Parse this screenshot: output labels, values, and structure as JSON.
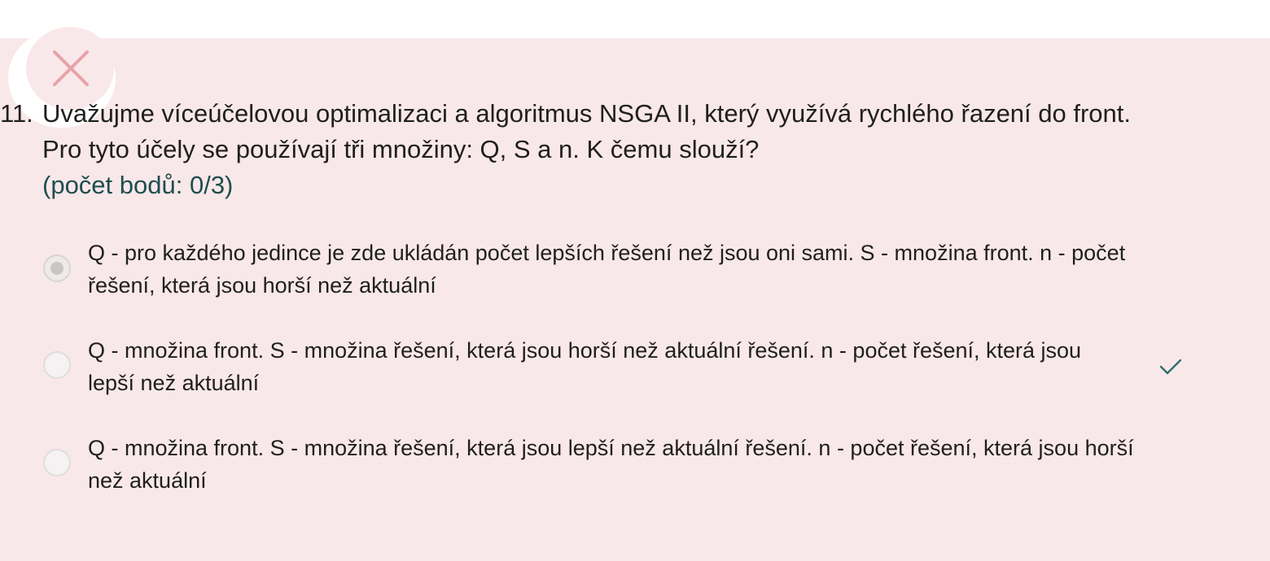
{
  "question": {
    "number": "11.",
    "text_line1": "Uvažujme víceúčelovou optimalizaci a algoritmus NSGA II, který využívá rychlého řazení do front.",
    "text_line2": "Pro tyto účely se používají tři množiny: Q, S a n. K čemu slouží?",
    "points": "(počet bodů: 0/3)",
    "status_icon": "close-icon"
  },
  "options": [
    {
      "line1": "Q - pro každého jedince je zde ukládán počet lepších řešení než jsou oni sami. S - množina front. n - počet",
      "line2": "řešení, která jsou horší než aktuální",
      "selected": true,
      "correct": false
    },
    {
      "line1": "Q - množina front. S - množina řešení, která jsou horší než aktuální řešení. n - počet řešení, která jsou",
      "line2": "lepší než aktuální",
      "selected": false,
      "correct": true,
      "marker_icon": "checkmark-icon"
    },
    {
      "line1": "Q - množina front. S - množina řešení, která jsou lepší než aktuální řešení. n - počet řešení, která jsou horší",
      "line2": "než aktuální",
      "selected": false,
      "correct": false
    }
  ],
  "colors": {
    "panel_background": "#f9e8e9",
    "wrong_mark": "#e8a3a8",
    "points_text": "#1e4e4e",
    "correct_mark": "#2f6f6f"
  }
}
